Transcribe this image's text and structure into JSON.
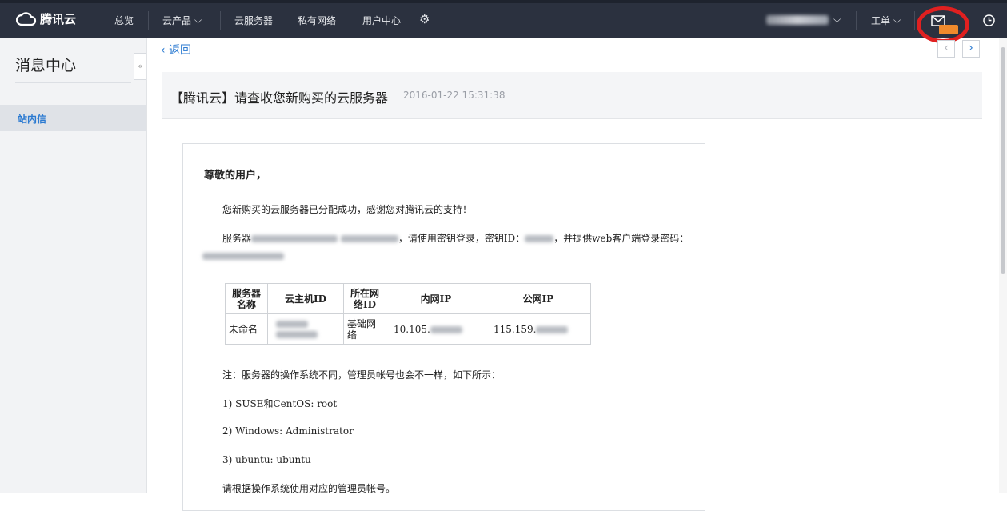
{
  "nav": {
    "brand": "腾讯云",
    "items": [
      "总览",
      "云产品",
      "云服务器",
      "私有网络",
      "用户中心"
    ],
    "ticket": "工单"
  },
  "sidebar": {
    "title": "消息中心",
    "items": [
      {
        "label": "站内信",
        "active": true
      }
    ],
    "collapse_glyph": "«"
  },
  "main": {
    "back_label": "返回",
    "subject": "【腾讯云】请查收您新购买的云服务器",
    "date": "2016-01-22 15:31:38"
  },
  "mail": {
    "greeting": "尊敬的用户，",
    "line1": "您新购买的云服务器已分配成功，感谢您对腾讯云的支持！",
    "line2_prefix": "服务器",
    "line2_mid": "，请使用密钥登录，密钥ID：",
    "line2_suffix": "，并提供web客户端登录密码：",
    "table": {
      "headers": [
        "服务器名称",
        "云主机ID",
        "所在网络ID",
        "内网IP",
        "公网IP"
      ],
      "row": {
        "name": "未命名",
        "network": "基础网络",
        "private_ip_prefix": "10.105.",
        "public_ip_prefix": "115.159."
      }
    },
    "note": "注：服务器的操作系统不同，管理员帐号也会不一样，如下所示：",
    "os_list": [
      "1) SUSE和CentOS: root",
      "2) Windows: Administrator",
      "3) ubuntu: ubuntu"
    ],
    "footer": "请根据操作系统使用对应的管理员帐号。"
  },
  "colors": {
    "nav_bg": "#2b313f",
    "accent": "#2b7ad1",
    "highlight": "#e02020",
    "badge": "#f08a2c"
  }
}
